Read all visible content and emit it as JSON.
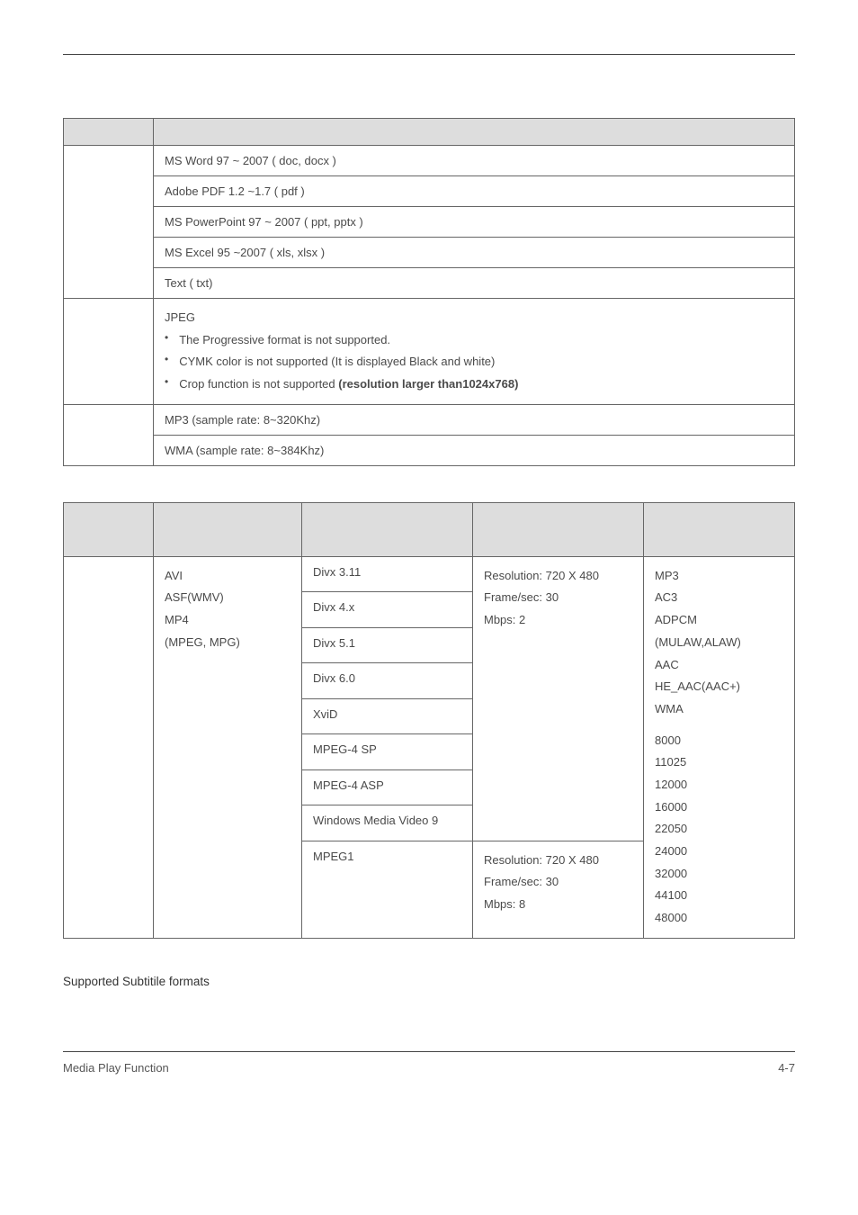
{
  "table1": {
    "rows": [
      "MS Word 97 ~ 2007 ( doc, docx )",
      "Adobe PDF 1.2 ~1.7 ( pdf )",
      "MS PowerPoint 97 ~ 2007 ( ppt, pptx )",
      "MS Excel 95 ~2007 ( xls, xlsx )",
      "Text ( txt)"
    ],
    "jpeg_label": "JPEG",
    "jpeg_bullets": [
      "The Progressive format is not supported.",
      "CYMK color is not supported (It is displayed Black and white)"
    ],
    "jpeg_bullet_mixed_prefix": "Crop function is not supported ",
    "jpeg_bullet_mixed_bold": "(resolution larger than1024x768)",
    "mp3_row": "MP3 (sample rate: 8~320Khz)",
    "wma_row": "WMA (sample rate: 8~384Khz)"
  },
  "table2": {
    "containers": [
      "AVI",
      "ASF(WMV)",
      "MP4",
      "(MPEG, MPG)"
    ],
    "codecs1": [
      "Divx 3.11",
      "Divx 4.x",
      "Divx 5.1",
      "Divx 6.0",
      "XviD",
      "MPEG-4 SP",
      "MPEG-4 ASP",
      "Windows Media Video 9"
    ],
    "spec1": [
      "Resolution: 720 X 480",
      "Frame/sec: 30",
      "Mbps: 2"
    ],
    "codec2": "MPEG1",
    "spec2": [
      "Resolution: 720 X 480",
      "Frame/sec: 30",
      "Mbps: 8"
    ],
    "audio1": [
      "MP3",
      "AC3",
      "ADPCM",
      "(MULAW,ALAW)",
      "AAC",
      "HE_AAC(AAC+)",
      "WMA"
    ],
    "audio2": [
      "8000",
      "11025",
      "12000",
      "16000",
      "22050",
      "24000",
      "32000",
      "44100",
      "48000"
    ]
  },
  "subtitle_heading": "Supported Subtitile formats",
  "footer": {
    "left": "Media Play Function",
    "right": "4-7"
  }
}
